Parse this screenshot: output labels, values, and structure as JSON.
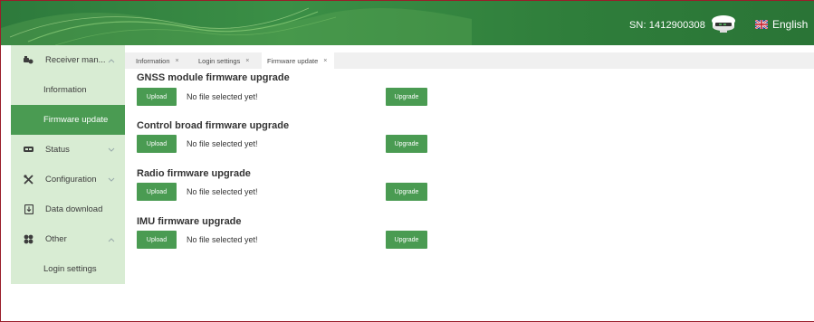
{
  "header": {
    "serial_label": "SN: 1412900308",
    "language": "English",
    "device_icon": "receiver-device-icon",
    "flag_icon": "uk-flag-icon",
    "colors": {
      "header_green": "#2f7e3b",
      "accent_green": "#4a9b52",
      "sidebar_bg": "#d8ecd3"
    }
  },
  "sidebar": {
    "items": [
      {
        "label": "Receiver man...",
        "icon": "receiver-icon"
      },
      {
        "label": "Information"
      },
      {
        "label": "Firmware update",
        "active": true
      },
      {
        "label": "Status",
        "icon": "status-icon"
      },
      {
        "label": "Configuration",
        "icon": "tools-icon"
      },
      {
        "label": "Data download",
        "icon": "download-icon"
      },
      {
        "label": "Other",
        "icon": "grid-icon"
      },
      {
        "label": "Login settings"
      }
    ]
  },
  "tabs": [
    {
      "label": "Information",
      "close": "×"
    },
    {
      "label": "Login settings",
      "close": "×"
    },
    {
      "label": "Firmware update",
      "close": "×"
    }
  ],
  "sections": [
    {
      "title": "GNSS module firmware upgrade",
      "upload_label": "Upload",
      "status": "No file selected yet!",
      "upgrade_label": "Upgrade"
    },
    {
      "title": "Control broad firmware upgrade",
      "upload_label": "Upload",
      "status": "No file selected yet!",
      "upgrade_label": "Upgrade"
    },
    {
      "title": "Radio firmware upgrade",
      "upload_label": "Upload",
      "status": "No file selected yet!",
      "upgrade_label": "Upgrade"
    },
    {
      "title": "IMU firmware upgrade",
      "upload_label": "Upload",
      "status": "No file selected yet!",
      "upgrade_label": "Upgrade"
    }
  ]
}
